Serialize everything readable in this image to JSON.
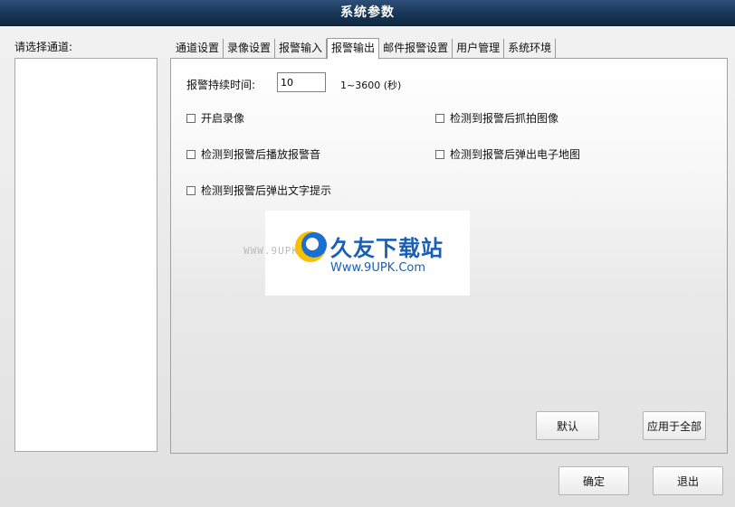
{
  "window": {
    "title": "系统参数"
  },
  "channel_select": {
    "label": "请选择通道:"
  },
  "tabs": [
    {
      "label": "通道设置"
    },
    {
      "label": "录像设置"
    },
    {
      "label": "报警输入"
    },
    {
      "label": "报警输出",
      "active": true
    },
    {
      "label": "邮件报警设置"
    },
    {
      "label": "用户管理"
    },
    {
      "label": "系统环境"
    }
  ],
  "alarm_output": {
    "duration_label": "报警持续时间:",
    "duration_value": "10",
    "duration_range": "1~3600 (秒)",
    "options": {
      "record": "开启录像",
      "snapshot": "检测到报警后抓拍图像",
      "sound": "检测到报警后播放报警音",
      "emap": "检测到报警后弹出电子地图",
      "text_tip": "检测到报警后弹出文字提示"
    }
  },
  "buttons": {
    "default": "默认",
    "apply_all": "应用于全部",
    "ok": "确定",
    "exit": "退出"
  },
  "watermark": {
    "site_name": "久友下载站",
    "url": "Www.9UPK.Com",
    "url_faint": "WWW.9UPK.COM",
    "brand_color": "#1a5fb4"
  }
}
